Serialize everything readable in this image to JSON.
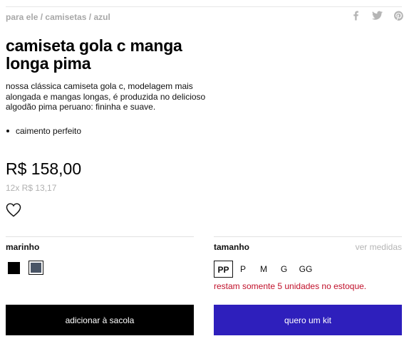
{
  "breadcrumb": {
    "items": [
      "para ele",
      "camisetas",
      "azul"
    ],
    "separator": " / "
  },
  "share": {
    "icons": [
      "facebook-icon",
      "twitter-icon",
      "pinterest-icon"
    ]
  },
  "product": {
    "title": "camiseta gola c manga longa pima",
    "description": "nossa clássica camiseta gola c, modelagem mais alongada e mangas longas, é produzida no delicioso algodão pima peruano: fininha e suave.",
    "features": [
      "caimento perfeito"
    ],
    "price": "R$ 158,00",
    "installments": "12x R$ 13,17"
  },
  "color": {
    "label": "marinho",
    "swatches": [
      {
        "name": "black",
        "hex": "#000000"
      },
      {
        "name": "marinho",
        "hex": "#4a5566",
        "selected": true
      }
    ]
  },
  "size": {
    "label": "tamanho",
    "measures_link": "ver medidas",
    "options": [
      "PP",
      "P",
      "M",
      "G",
      "GG"
    ],
    "selected": "PP",
    "stock_message": "restam somente 5 unidades no estoque."
  },
  "actions": {
    "add_to_bag": "adicionar à sacola",
    "kit": "quero um kit"
  },
  "colors": {
    "text": "#111111",
    "muted": "#b0b0b0",
    "alert": "#c0102a",
    "primary_button": "#000000",
    "kit_button": "#2e1fbc"
  }
}
